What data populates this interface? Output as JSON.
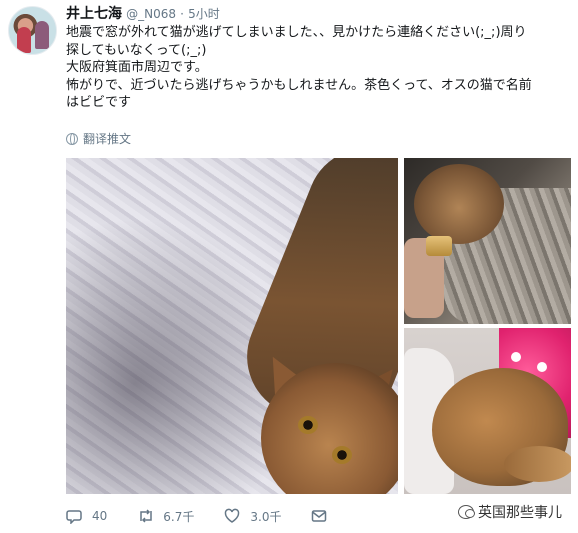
{
  "tweet": {
    "author_name": "井上七海",
    "handle": "@_N068",
    "separator": "·",
    "time": "5小时",
    "lines": [
      "地震で窓が外れて猫が逃げてしまいました、、見かけたら連絡ください(;_;)周り",
      "探してもいなくって(;_;)",
      "大阪府箕面市周辺です。",
      "怖がりで、近づいたら逃げちゃうかもしれません。茶色くって、オスの猫で名前",
      "はビビです"
    ],
    "translate_label": "翻译推文"
  },
  "actions": {
    "reply_count": "40",
    "retweet_count": "6.7千",
    "like_count": "3.0千"
  },
  "icons": [
    "reply-icon",
    "retweet-icon",
    "like-icon",
    "direct-message-icon",
    "translate-globe-icon",
    "wechat-icon"
  ],
  "watermark": {
    "text": "英国那些事儿"
  },
  "colors": {
    "text": "#14171a",
    "secondary": "#657786"
  }
}
